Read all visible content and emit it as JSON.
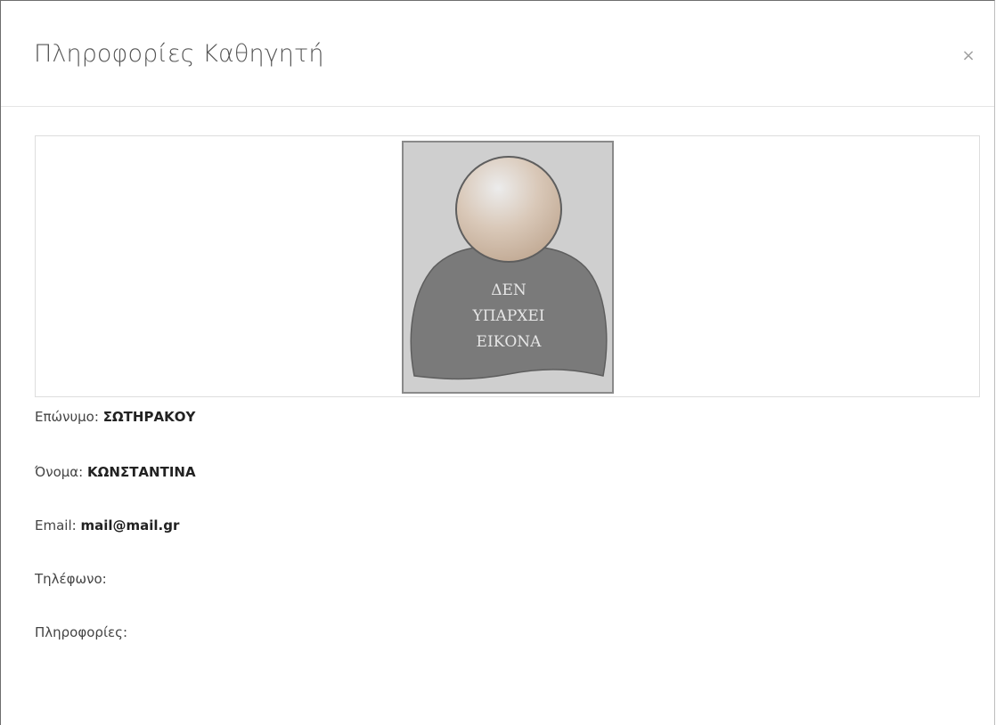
{
  "modal": {
    "title": "Πληροφορίες Καθηγητή",
    "close_symbol": "×",
    "close_icon": "close-icon"
  },
  "photo": {
    "placeholder_line1": "ΔΕΝ",
    "placeholder_line2": "ΥΠΑΡΧΕΙ",
    "placeholder_line3": "ΕΙΚΟΝΑ",
    "icon": "person-silhouette-icon"
  },
  "fields": {
    "surname_label": "Επώνυμο:",
    "surname_value": "ΣΩΤΗΡΑΚΟΥ",
    "name_label": "Όνομα:",
    "name_value": "ΚΩΝΣΤΑΝΤΙΝΑ",
    "email_label": "Email:",
    "email_value": "mail@mail.gr",
    "phone_label": "Τηλέφωνο:",
    "phone_value": "",
    "info_label": "Πληροφορίες:",
    "info_value": ""
  },
  "colors": {
    "silhouette_body": "#7a7a7a",
    "silhouette_head": "#d9c8b8",
    "photo_background": "#cfcfcf",
    "placeholder_text": "#e6e6e6"
  }
}
